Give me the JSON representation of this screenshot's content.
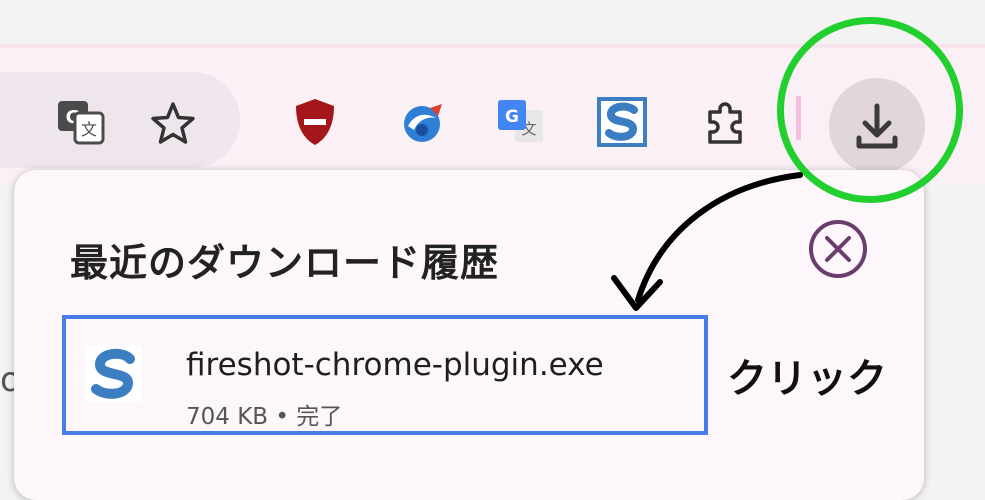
{
  "toolbar": {
    "extensions": [
      {
        "name": "translate-page-icon"
      },
      {
        "name": "bookmark-star-icon"
      },
      {
        "name": "ublock-shield-icon"
      },
      {
        "name": "extension-globe-icon"
      },
      {
        "name": "google-translate-icon"
      },
      {
        "name": "fireshot-s-icon"
      },
      {
        "name": "extensions-puzzle-icon"
      }
    ],
    "download_button_icon": "download-icon"
  },
  "download_panel": {
    "title": "最近のダウンロード履歴",
    "close_icon": "close-circle-icon",
    "item": {
      "file_name": "fireshot-chrome-plugin.exe",
      "meta": "704 KB • 完了",
      "file_icon": "fireshot-file-icon"
    }
  },
  "annotation": {
    "label": "クリック",
    "ring_color": "#21d02e",
    "highlight_color": "#4a7ce8"
  },
  "colors": {
    "toolbar_bg": "#fbf0f6",
    "panel_bg": "#fdf7fb",
    "shield_red": "#a4161a",
    "fireshot_blue": "#3b7fc2"
  }
}
